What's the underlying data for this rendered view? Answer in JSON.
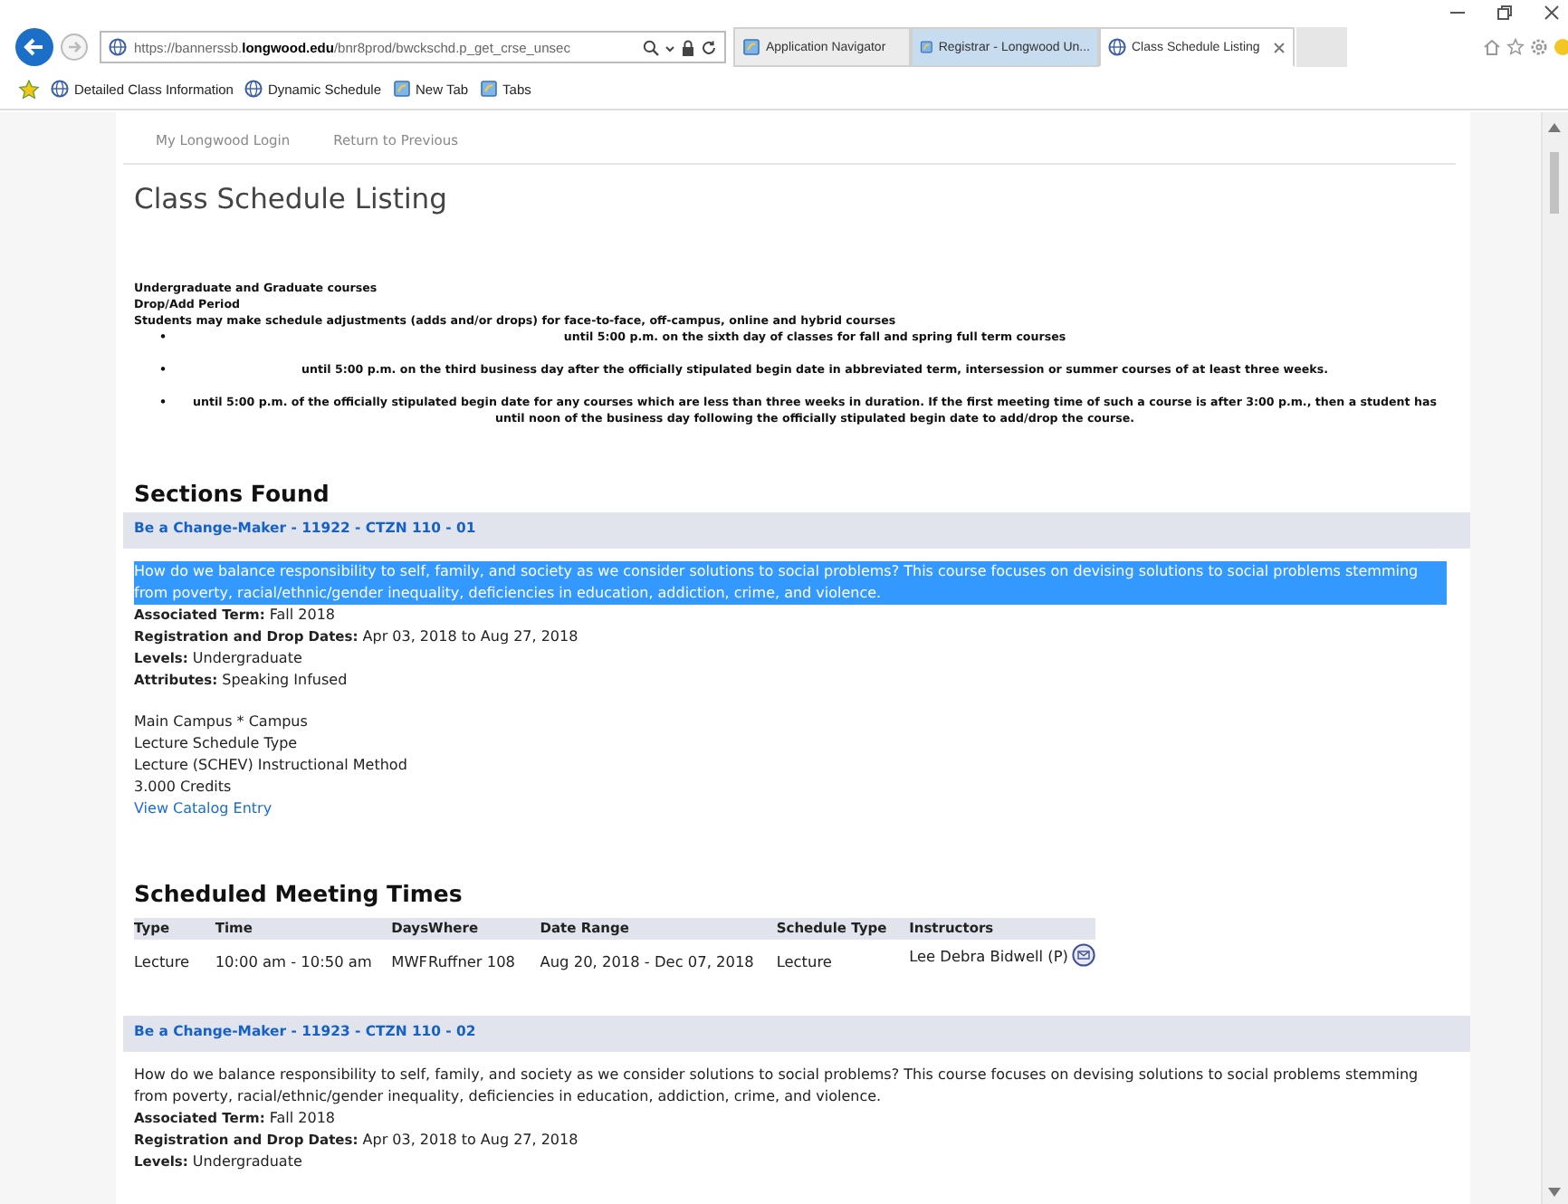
{
  "browser": {
    "address": "https://bannerssb.**longwood.edu**/bnr8prod/bwckschd.p_get_crse_unsec",
    "tabs": [
      {
        "label": "Application Navigator",
        "kind": "app",
        "selected": false,
        "hovered": false
      },
      {
        "label": "Registrar - Longwood Un...",
        "kind": "app",
        "selected": false,
        "hovered": true
      },
      {
        "label": "Class Schedule Listing",
        "kind": "globe",
        "selected": true,
        "hovered": false
      }
    ],
    "favorites": [
      {
        "label": "Detailed Class Information",
        "kind": "globe"
      },
      {
        "label": "Dynamic Schedule",
        "kind": "globe"
      },
      {
        "label": "New Tab",
        "kind": "app"
      },
      {
        "label": "Tabs",
        "kind": "app"
      }
    ]
  },
  "page": {
    "nav_links": [
      "My Longwood Login",
      "Return to Previous"
    ],
    "title": "Class Schedule Listing",
    "notice_lines": [
      "Undergraduate and Graduate courses",
      "Drop/Add Period",
      "Students may make schedule adjustments (adds and/or drops) for face-to-face, off-campus, online and hybrid courses"
    ],
    "notice_bullets": [
      {
        "marker": "•",
        "text": "until 5:00 p.m. on the sixth day of classes for fall and spring full term courses"
      },
      {
        "marker": "•",
        "text": "until 5:00 p.m. on the third business day after the officially stipulated begin date in abbreviated term, intersession or summer courses of at least three weeks."
      },
      {
        "marker": "•",
        "text": "until 5:00 p.m. of the officially stipulated begin date for any courses which are less than three weeks in duration. If the first meeting time of such a course is after 3:00 p.m., then a student has until noon of the business day following the officially stipulated begin date to add/drop the course."
      }
    ],
    "sections_heading": "Sections Found",
    "sections": [
      {
        "title": "Be a Change-Maker - 11922 - CTZN 110 - 01",
        "description": "How do we balance responsibility to self, family, and society as we consider solutions to social problems? This course focuses on devising solutions to social problems stemming from poverty, racial/ethnic/gender inequality, deficiencies in education, addiction, crime, and violence.",
        "selected": true,
        "fields": [
          {
            "label": "Associated Term:",
            "value": "Fall 2018"
          },
          {
            "label": "Registration and Drop Dates:",
            "value": "Apr 03, 2018 to Aug 27, 2018"
          },
          {
            "label": "Levels:",
            "value": "Undergraduate"
          },
          {
            "label": "Attributes:",
            "value": "Speaking Infused"
          }
        ],
        "details": [
          "Main Campus * Campus",
          "Lecture Schedule Type",
          "Lecture (SCHEV) Instructional Method",
          "3.000 Credits"
        ],
        "catalog_link": "View Catalog Entry",
        "meeting_heading": "Scheduled Meeting Times",
        "meeting_columns": [
          "Type",
          "Time",
          "Days",
          "Where",
          "Date Range",
          "Schedule Type",
          "Instructors"
        ],
        "meeting_rows": [
          [
            "Lecture",
            "10:00 am - 10:50 am",
            "MWF",
            "Ruffner 108",
            "Aug 20, 2018 - Dec 07, 2018",
            "Lecture",
            "Lee Debra Bidwell (P)"
          ]
        ]
      },
      {
        "title": "Be a Change-Maker - 11923 - CTZN 110 - 02",
        "description": "How do we balance responsibility to self, family, and society as we consider solutions to social problems? This course focuses on devising solutions to social problems stemming from poverty, racial/ethnic/gender inequality, deficiencies in education, addiction, crime, and violence.",
        "selected": false,
        "fields": [
          {
            "label": "Associated Term:",
            "value": "Fall 2018"
          },
          {
            "label": "Registration and Drop Dates:",
            "value": "Apr 03, 2018 to Aug 27, 2018"
          },
          {
            "label": "Levels:",
            "value": "Undergraduate"
          }
        ]
      }
    ]
  }
}
